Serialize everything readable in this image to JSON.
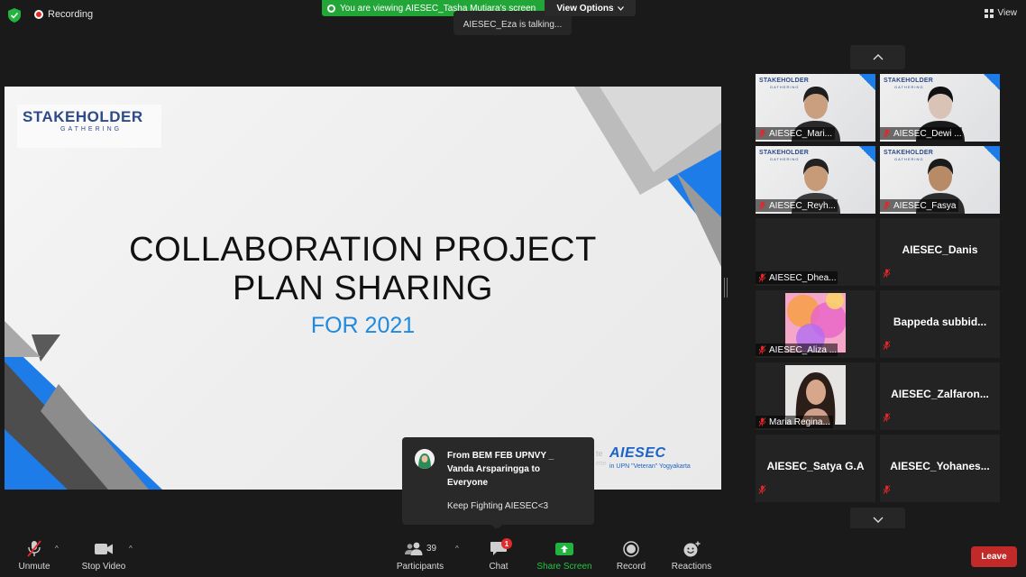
{
  "top_bar": {
    "recording_label": "Recording",
    "share_banner": "You are viewing AIESEC_Tasha Mutiara's screen",
    "view_options_label": "View Options",
    "talking_label": "AIESEC_Eza is talking...",
    "view_label": "View"
  },
  "slide": {
    "logo_main": "STAKEHOLDER",
    "logo_sub": "GATHERING",
    "title_line1": "COLLABORATION PROJECT",
    "title_line2": "PLAN SHARING",
    "title_line3": "FOR 2021",
    "footer_brand": "AIESEC",
    "footer_sub": "in UPN \"Veteran\" Yogyakarta",
    "faint_text1": "te",
    "faint_text2": "ette"
  },
  "gallery": {
    "video_logo_main": "STAKEHOLDER",
    "video_logo_sub": "GATHERING",
    "tiles": [
      {
        "name": "AIESEC_Mari..."
      },
      {
        "name": "AIESEC_Dewi ..."
      },
      {
        "name": "AIESEC_Reyh..."
      },
      {
        "name": "AIESEC_Fasya"
      },
      {
        "name": "AIESEC_Dhea..."
      },
      {
        "name": "AIESEC_Danis"
      },
      {
        "name": "AIESEC_Aliza ..."
      },
      {
        "name": "Bappeda  subbid..."
      },
      {
        "name": "Maria Regina..."
      },
      {
        "name": "AIESEC_Zalfaron..."
      },
      {
        "name": "AIESEC_Satya G.A"
      },
      {
        "name": "AIESEC_Yohanes..."
      }
    ]
  },
  "chat_toast": {
    "from": "From BEM FEB UPNVY _ Vanda Arsparingga to Everyone",
    "message": "Keep Fighting AIESEC<3"
  },
  "toolbar": {
    "unmute": "Unmute",
    "stop_video": "Stop Video",
    "participants": "Participants",
    "participants_count": "39",
    "chat": "Chat",
    "chat_badge": "1",
    "share_screen": "Share Screen",
    "record": "Record",
    "reactions": "Reactions",
    "leave": "Leave"
  },
  "colors": {
    "share_green": "#23a638",
    "leave_red": "#c22a2a",
    "slide_blue": "#1e7ce8",
    "title_blue": "#1f8ae0"
  }
}
